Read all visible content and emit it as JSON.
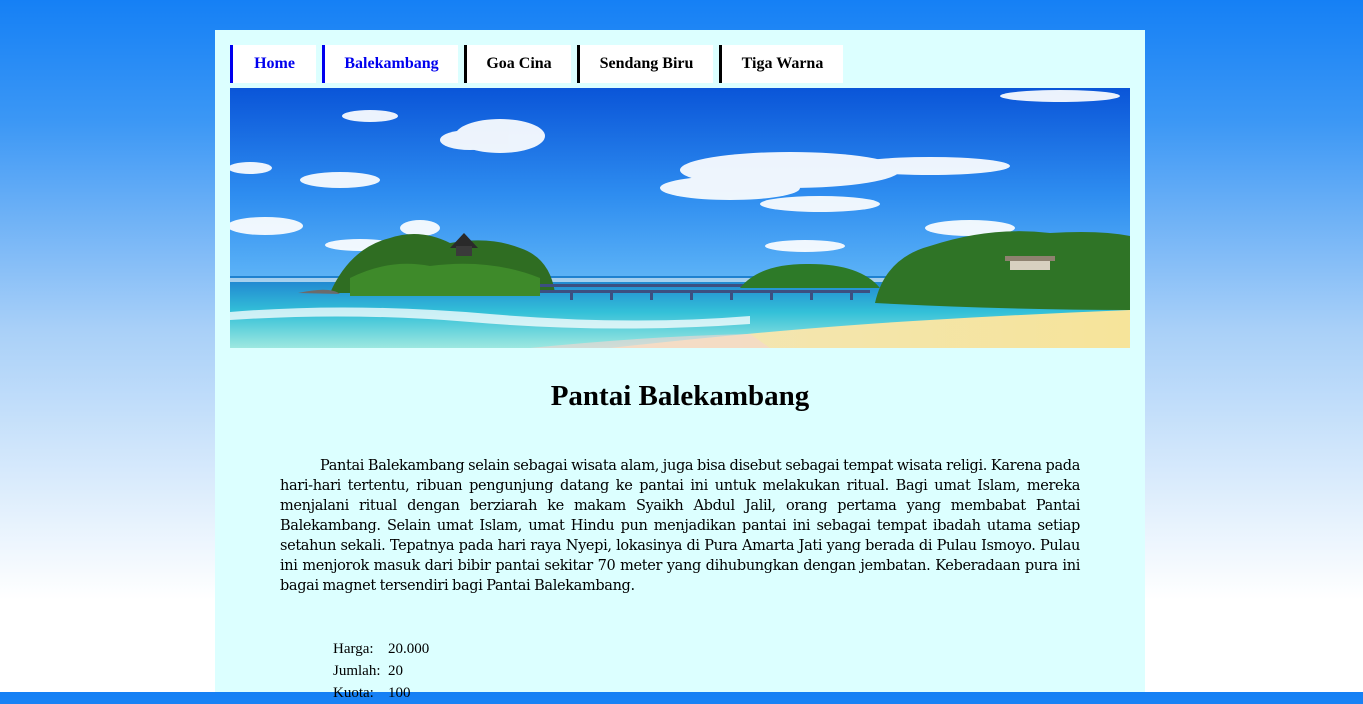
{
  "nav": {
    "items": [
      {
        "label": "Home",
        "active": true
      },
      {
        "label": "Balekambang",
        "active": true
      },
      {
        "label": "Goa Cina",
        "active": false
      },
      {
        "label": "Sendang Biru",
        "active": false
      },
      {
        "label": "Tiga Warna",
        "active": false
      }
    ]
  },
  "main": {
    "title": "Pantai Balekambang",
    "description": "Pantai Balekambang selain sebagai wisata alam, juga bisa disebut sebagai tempat wisata religi. Karena pada hari-hari tertentu, ribuan pengunjung datang ke pantai ini untuk melakukan ritual. Bagi umat Islam, mereka menjalani ritual dengan berziarah ke makam Syaikh Abdul Jalil, orang pertama yang membabat Pantai Balekambang. Selain umat Islam, umat Hindu pun menjadikan pantai ini sebagai tempat ibadah utama setiap setahun sekali. Tepatnya pada hari raya Nyepi, lokasinya di Pura Amarta Jati yang berada di Pulau Ismoyo. Pulau ini menjorok masuk dari bibir pantai sekitar 70 meter yang dihubungkan dengan jembatan. Keberadaan pura ini bagai magnet tersendiri bagi Pantai Balekambang."
  },
  "info": {
    "price_label": "Harga:",
    "price_value": "20.000",
    "quantity_label": "Jumlah:",
    "quantity_value": "20",
    "third_label": "Kuota:",
    "third_value": "100"
  },
  "colors": {
    "panel_bg": "#dcffff",
    "active_link": "#0000ee",
    "sky_top": "#1580f5"
  }
}
